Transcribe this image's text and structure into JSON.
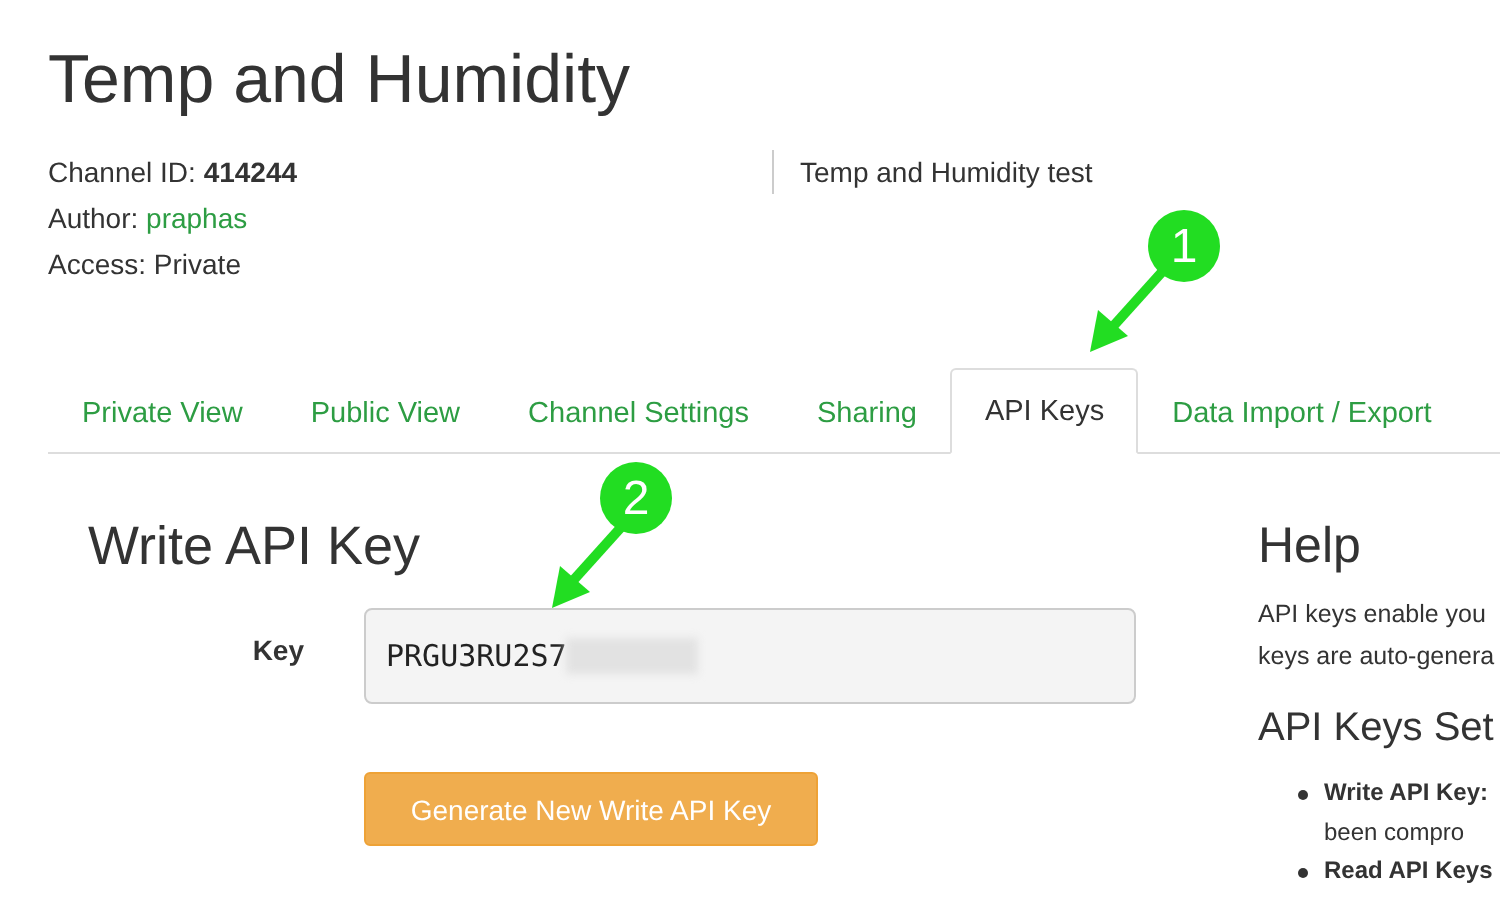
{
  "channel": {
    "title": "Temp and Humidity",
    "id_label": "Channel ID:",
    "id": "414244",
    "author_label": "Author:",
    "author": "praphas",
    "access": "Access: Private",
    "description": "Temp and Humidity test"
  },
  "tabs": [
    {
      "label": "Private View",
      "selected": false
    },
    {
      "label": "Public View",
      "selected": false
    },
    {
      "label": "Channel Settings",
      "selected": false
    },
    {
      "label": "Sharing",
      "selected": false
    },
    {
      "label": "API Keys",
      "selected": true,
      "callout": "1"
    },
    {
      "label": "Data Import / Export",
      "selected": false
    }
  ],
  "write_key": {
    "heading": "Write API Key",
    "label": "Key",
    "value": "PRGU3RU2S7",
    "redacted": true,
    "callout": "2",
    "button": "Generate New Write API Key"
  },
  "help": {
    "heading": "Help",
    "lines": [
      "API keys enable you",
      "keys are auto-genera"
    ],
    "subheading": "API Keys Set",
    "bullets": [
      {
        "lines": [
          "**Write API Key:**",
          "been compro"
        ]
      },
      {
        "lines": [
          "**Read API Keys**"
        ]
      }
    ]
  }
}
